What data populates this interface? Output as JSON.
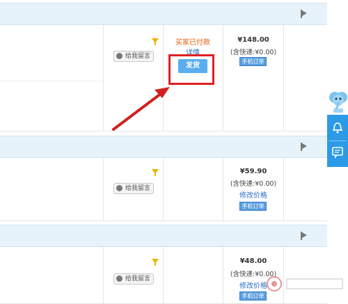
{
  "rows": [
    {
      "message_label": "给我留言",
      "status": "买家已付款",
      "detail_link": "详情",
      "ship_button": "发货",
      "price": "¥148.00",
      "express": "(含快递:¥0.00)",
      "mobile_tag": "手机订单"
    },
    {
      "message_label": "给我留言",
      "price": "¥59.90",
      "express": "(含快递:¥0.00)",
      "modify_price": "修改价格",
      "mobile_tag": "手机订单"
    },
    {
      "message_label": "给我留言",
      "price": "¥48.00",
      "express": "(含快递:¥0.00)",
      "modify_price": "修改价格",
      "mobile_tag": "手机订单"
    }
  ],
  "colors": {
    "header_bg": "#e6f3fb",
    "ship_button": "#59aef0",
    "highlight_frame": "#e02020",
    "status_text": "#e05a00",
    "link_text": "#2a6cc7",
    "side_widget": "#2b9be8"
  },
  "icons": [
    "flag-icon",
    "funnel-icon",
    "message-bubble-icon",
    "bell-icon",
    "chat-icon",
    "elephant-mascot-icon",
    "annotation-arrow"
  ]
}
